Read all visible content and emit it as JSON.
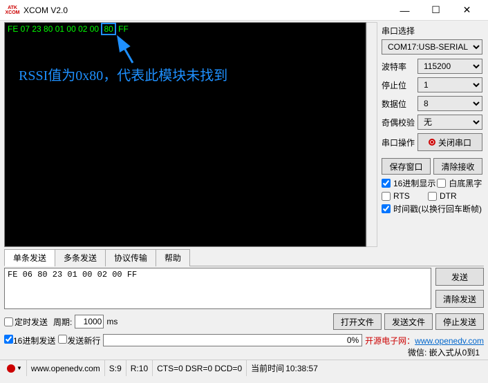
{
  "window": {
    "title": "XCOM V2.0",
    "logo_line1": "ATK",
    "logo_line2": "XCOM"
  },
  "terminal": {
    "hex_before": "FE 07 23 80 01 00 02 00 ",
    "hex_highlight": "80",
    "hex_after": " FF",
    "annotation": "RSSI值为0x80，代表此模块未找到"
  },
  "side": {
    "port_section": "串口选择",
    "port_value": "COM17:USB-SERIAL",
    "baud_label": "波特率",
    "baud_value": "115200",
    "stop_label": "停止位",
    "stop_value": "1",
    "data_label": "数据位",
    "data_value": "8",
    "parity_label": "奇偶校验",
    "parity_value": "无",
    "op_label": "串口操作",
    "op_button": "关闭串口",
    "save_btn": "保存窗口",
    "clear_rx_btn": "清除接收",
    "chk_hex_disp": "16进制显示",
    "chk_white_bg": "白底黑字",
    "chk_rts": "RTS",
    "chk_dtr": "DTR",
    "chk_timestamp": "时间戳(以换行回车断帧)"
  },
  "tabs": {
    "t1": "单条发送",
    "t2": "多条发送",
    "t3": "协议传输",
    "t4": "帮助"
  },
  "send": {
    "text": "FE 06 80 23 01 00 02 00 FF",
    "send_btn": "发送",
    "clear_btn": "清除发送"
  },
  "ctrl": {
    "timed_send": "定时发送",
    "period_label": "周期:",
    "period_value": "1000",
    "period_unit": "ms",
    "open_file": "打开文件",
    "send_file": "发送文件",
    "stop_send": "停止发送",
    "hex_send": "16进制发送",
    "send_newline": "发送新行",
    "progress": "0%",
    "promo_red": "开源电子网：",
    "promo_link": "www.openedv.com",
    "promo_wechat_label": "微信:",
    "promo_wechat": "嵌入式从0到1"
  },
  "status": {
    "url": "www.openedv.com",
    "s": "S:9",
    "r": "R:10",
    "cts": "CTS=0 DSR=0 DCD=0",
    "time_label": "当前时间",
    "time_value": "10:38:57"
  }
}
